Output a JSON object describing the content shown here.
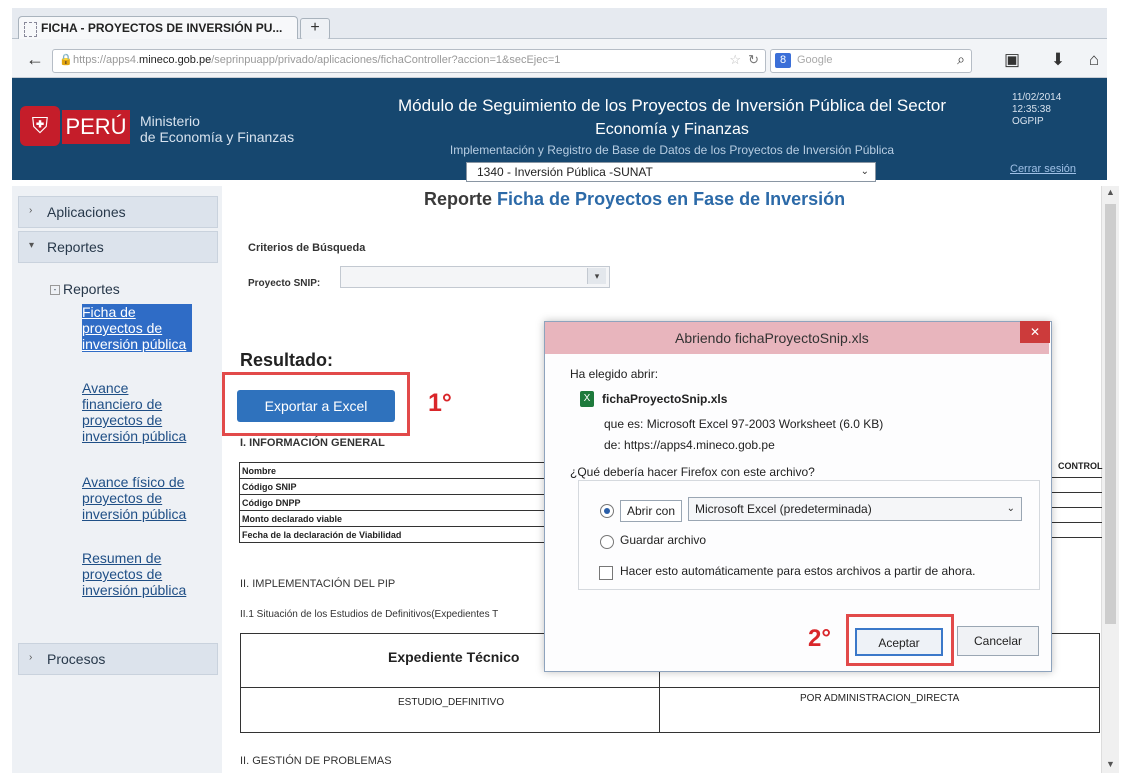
{
  "browser": {
    "tab_title": "FICHA - PROYECTOS DE INVERSIÓN PU...",
    "new_tab": "+",
    "url_prefix": "https://apps4.",
    "url_domain": "mineco.gob.pe",
    "url_rest": "/seprinpuapp/privado/aplicaciones/fichaController?accion=1&secEjec=1",
    "search_placeholder": "Google"
  },
  "header": {
    "country": "PERÚ",
    "ministry_line1": "Ministerio",
    "ministry_line2": "de Economía y Finanzas",
    "title_line1": "Módulo de Seguimiento de los Proyectos de Inversión Pública del Sector",
    "title_line2": "Economía y Finanzas",
    "subtitle": "Implementación y Registro de Base de Datos de los Proyectos de Inversión Pública",
    "date": "11/02/2014",
    "time": "12:35:38",
    "office": "OGPIP",
    "logout": "Cerrar sesión",
    "unit_selected": "1340 - Inversión Pública -SUNAT"
  },
  "sidebar": {
    "aplicaciones": "Aplicaciones",
    "reportes": "Reportes",
    "reportes_sub": "Reportes",
    "links": [
      "Ficha de proyectos de inversión pública",
      "Avance financiero de proyectos de inversión pública",
      "Avance físico de proyectos de inversión pública",
      "Resumen de proyectos de inversión pública"
    ],
    "procesos": "Procesos"
  },
  "report": {
    "title_prefix": "Reporte",
    "title_main": "Ficha de Proyectos en Fase de Inversión",
    "criterios": "Criterios de Búsqueda",
    "snip_label": "Proyecto SNIP:",
    "resultado": "Resultado:",
    "export_button": "Exportar a Excel",
    "step1": "1°",
    "info_general": "I. INFORMACIÓN GENERAL",
    "info_rows": [
      "Nombre",
      "Código SNIP",
      "Código DNPP",
      "Monto declarado viable",
      "Fecha de la declaración de Viabilidad"
    ],
    "control": "CONTROL",
    "implementacion": "II. IMPLEMENTACIÓN DEL PIP",
    "situacion": "II.1 Situación de los Estudios de Definitivos(Expedientes T",
    "expediente": "Expediente Técnico",
    "estudio": "ESTUDIO_DEFINITIVO",
    "modalidad": "POR ADMINISTRACION_DIRECTA",
    "gestion": "II. GESTIÓN DE PROBLEMAS"
  },
  "dialog": {
    "title": "Abriendo fichaProyectoSnip.xls",
    "close": "✕",
    "elegido": "Ha elegido abrir:",
    "filename": "fichaProyectoSnip.xls",
    "type": "que es:  Microsoft Excel 97-2003 Worksheet (6.0 KB)",
    "from": "de:  https://apps4.mineco.gob.pe",
    "question": "¿Qué debería hacer Firefox con este archivo?",
    "open_with_label": "Abrir con",
    "open_with_value": "Microsoft Excel (predeterminada)",
    "save_label": "Guardar archivo",
    "auto_label": "Hacer esto automáticamente para estos archivos a partir de ahora.",
    "step2": "2°",
    "accept": "Aceptar",
    "cancel": "Cancelar"
  },
  "colors": {
    "header_bg": "#16476f",
    "brand_red": "#c51d2a",
    "export_button": "#2f72bd",
    "annotation_red": "#d9262a"
  }
}
